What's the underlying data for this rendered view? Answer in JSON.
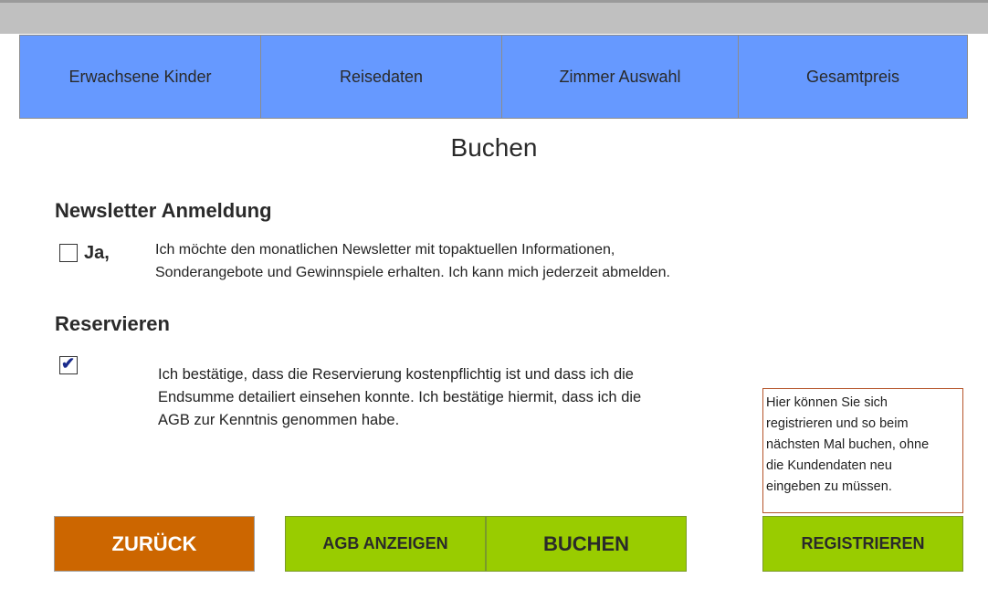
{
  "tabs": [
    {
      "label": "Erwachsene Kinder"
    },
    {
      "label": "Reisedaten"
    },
    {
      "label": "Zimmer Auswahl"
    },
    {
      "label": "Gesamtpreis"
    }
  ],
  "page": {
    "title": "Buchen"
  },
  "newsletter": {
    "heading": "Newsletter Anmeldung",
    "checkbox_label": "Ja,",
    "checked": false,
    "text_line1": "Ich möchte den monatlichen Newsletter mit topaktuellen Informationen,",
    "text_line2": "Sonderangebote und Gewinnspiele erhalten. Ich kann mich jederzeit abmelden."
  },
  "reservation": {
    "heading": "Reservieren",
    "checked": true,
    "checkmark": "✔",
    "text_line1": "Ich bestätige, dass die Reservierung kostenpflichtig ist und dass ich die",
    "text_line2": "Endsumme detailiert einsehen konnte. Ich bestätige hiermit, dass ich die",
    "text_line3": "AGB zur Kenntnis genommen habe."
  },
  "info_box": {
    "line1": "Hier können Sie sich",
    "line2": "registrieren und so beim",
    "line3": "nächsten Mal buchen, ohne",
    "line4": "die Kundendaten neu",
    "line5": "eingeben zu müssen."
  },
  "buttons": {
    "back": "ZURÜCK",
    "agb": "AGB ANZEIGEN",
    "book": "BUCHEN",
    "register": "REGISTRIEREN"
  },
  "colors": {
    "tab_bg": "#6699ff",
    "back_button": "#cc6600",
    "green_button": "#99cc00",
    "info_border": "#b5552b"
  }
}
